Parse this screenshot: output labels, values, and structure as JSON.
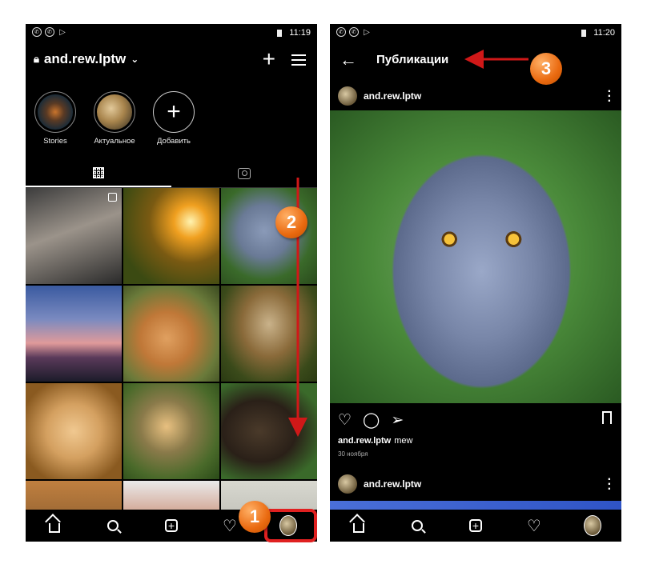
{
  "left_screen": {
    "status_time": "11:19",
    "username": "and.rew.lptw",
    "highlights": [
      {
        "label": "Stories"
      },
      {
        "label": "Актуальное"
      },
      {
        "label": "Добавить"
      }
    ],
    "active_tab": "grid"
  },
  "right_screen": {
    "status_time": "11:20",
    "title": "Публикации",
    "post": {
      "username": "and.rew.lptw",
      "caption_user": "and.rew.lptw",
      "caption_text": "mew",
      "date": "30 ноября"
    },
    "next_post_username": "and.rew.lptw"
  },
  "markers": [
    {
      "number": "1"
    },
    {
      "number": "2"
    },
    {
      "number": "3"
    }
  ],
  "colors": {
    "marker_orange": "#ea6a10",
    "highlight_red": "#e02020",
    "background": "#000000"
  },
  "icons": [
    "lock-icon",
    "chevron-down-icon",
    "plus-icon",
    "menu-icon",
    "grid-icon",
    "tagged-icon",
    "home-icon",
    "search-icon",
    "new-post-icon",
    "heart-icon",
    "back-arrow-icon",
    "comment-icon",
    "share-icon",
    "bookmark-icon",
    "more-icon"
  ]
}
